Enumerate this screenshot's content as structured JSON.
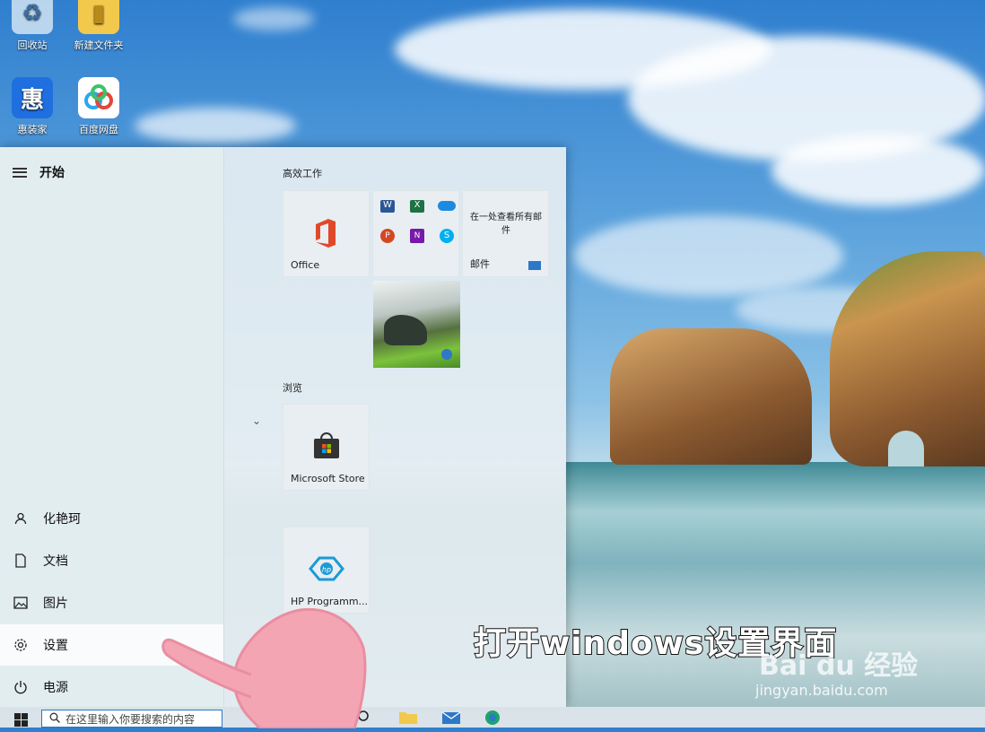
{
  "desktop": {
    "icons": [
      {
        "label": "回收站"
      },
      {
        "label": "新建文件夹"
      },
      {
        "label": "惠装家"
      },
      {
        "label": "百度网盘"
      }
    ]
  },
  "start_menu": {
    "header": "开始",
    "nav": [
      {
        "label": "化艳珂",
        "icon": "user-icon"
      },
      {
        "label": "文档",
        "icon": "document-icon"
      },
      {
        "label": "图片",
        "icon": "picture-icon"
      },
      {
        "label": "设置",
        "icon": "gear-icon"
      },
      {
        "label": "电源",
        "icon": "power-icon"
      }
    ],
    "groups": [
      {
        "title": "高效工作"
      },
      {
        "title": "浏览"
      }
    ],
    "tiles": {
      "office": "Office",
      "mail_desc": "在一处查看所有邮件",
      "mail": "邮件",
      "store": "Microsoft Store",
      "hp": "HP Programm..."
    }
  },
  "taskbar": {
    "search_placeholder": "在这里输入你要搜索的内容"
  },
  "overlay": {
    "caption": "打开windows设置界面",
    "watermark_logo": "Bai du 经验",
    "watermark_url": "jingyan.baidu.com"
  },
  "colors": {
    "accent": "#2d78c8",
    "office_red": "#e0482c",
    "hand_pink": "#f4a5b4"
  }
}
